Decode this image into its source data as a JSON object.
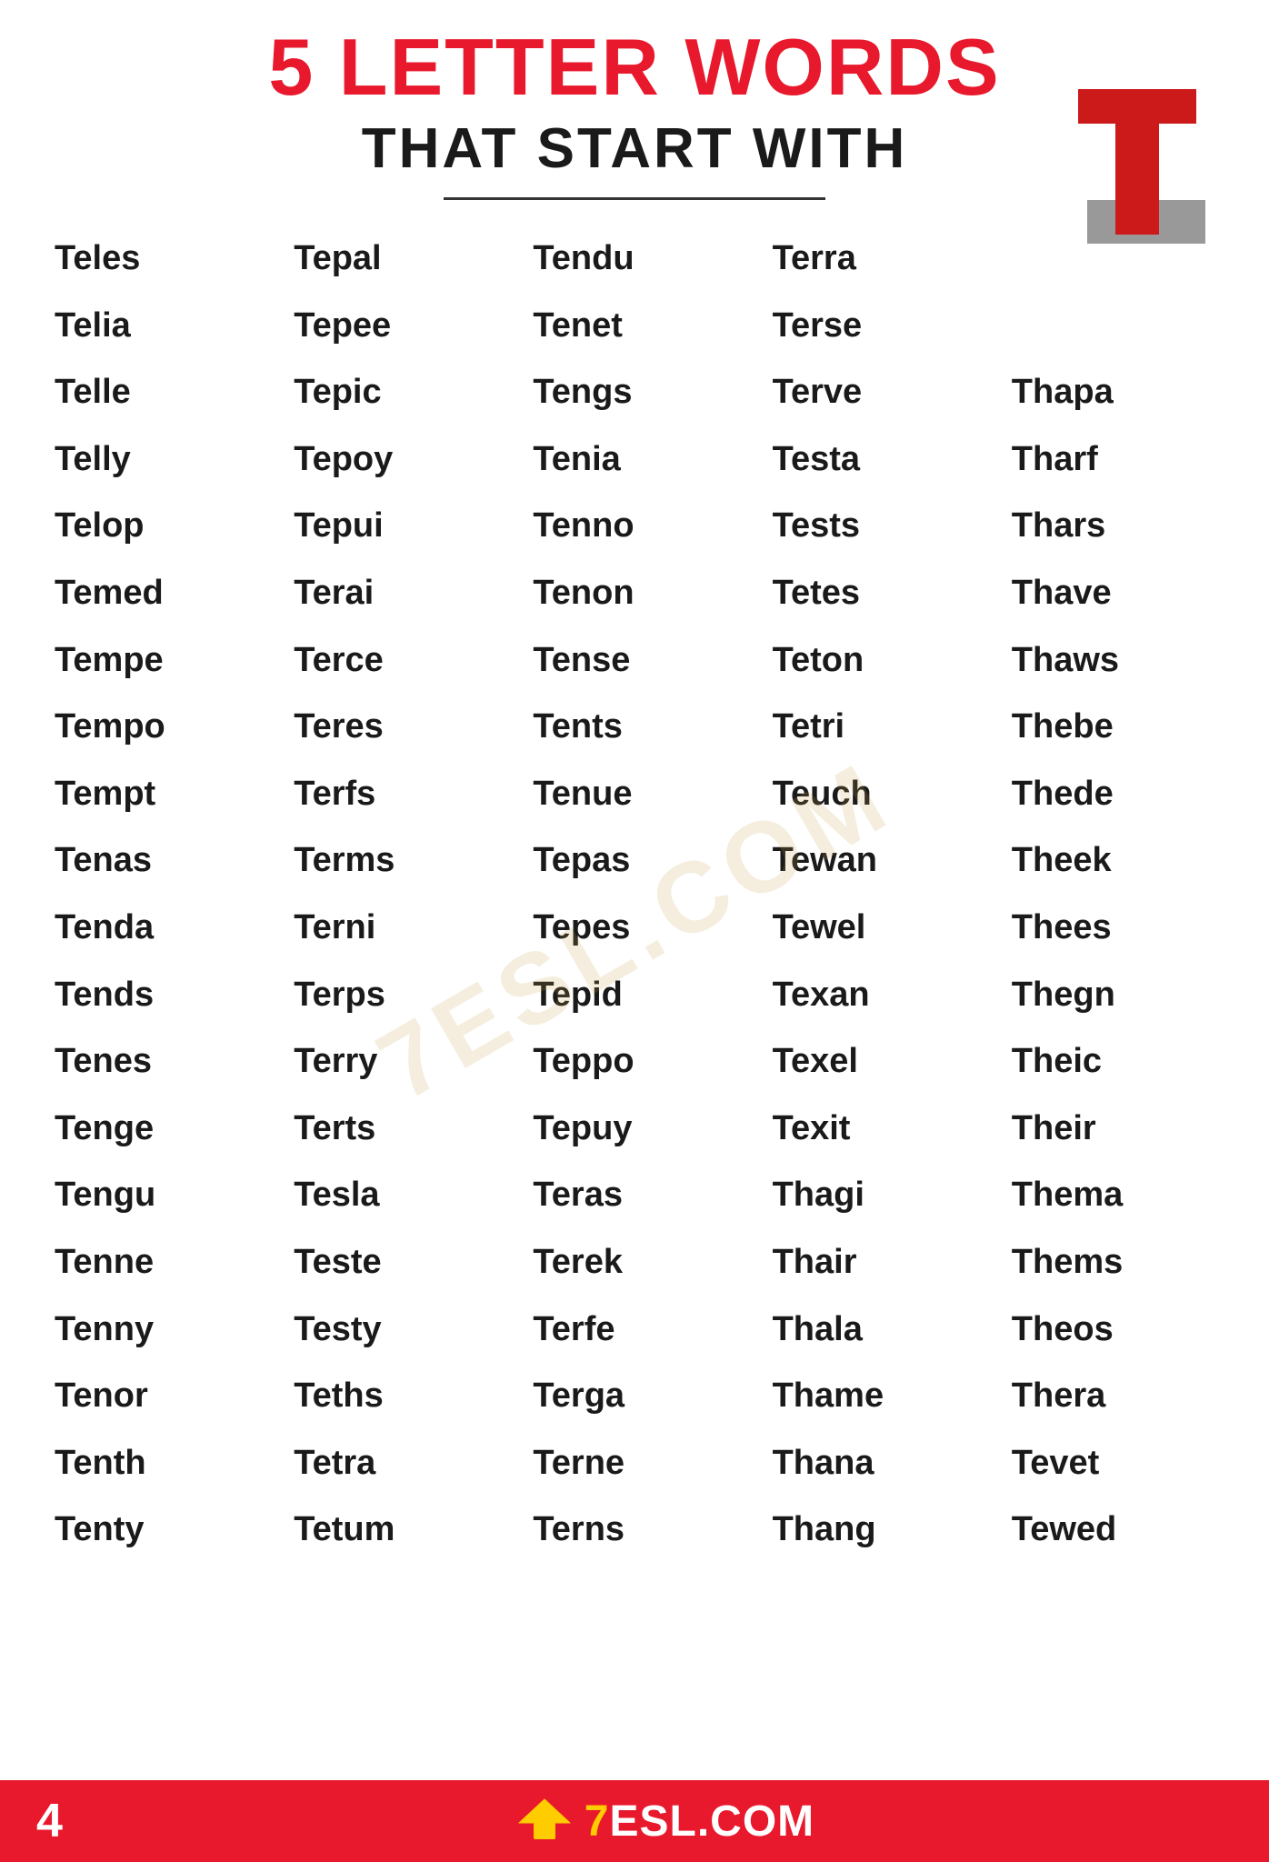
{
  "header": {
    "main_title": "5 LETTER WORDS",
    "subtitle": "THAT START WITH",
    "big_letter": "T"
  },
  "footer": {
    "page_number": "4",
    "logo_text": "7ESL.COM"
  },
  "words": [
    [
      "Teles",
      "Tepal",
      "Tendu",
      "Terra",
      ""
    ],
    [
      "Telia",
      "Tepee",
      "Tenet",
      "Terse",
      ""
    ],
    [
      "Telle",
      "Tepic",
      "Tengs",
      "Terve",
      "Thapa"
    ],
    [
      "Telly",
      "Tepoy",
      "Tenia",
      "Testa",
      "Tharf"
    ],
    [
      "Telop",
      "Tepui",
      "Tenno",
      "Tests",
      "Thars"
    ],
    [
      "Temed",
      "Terai",
      "Tenon",
      "Tetes",
      "Thave"
    ],
    [
      "Tempe",
      "Terce",
      "Tense",
      "Teton",
      "Thaws"
    ],
    [
      "Tempo",
      "Teres",
      "Tents",
      "Tetri",
      "Thebe"
    ],
    [
      "Tempt",
      "Terfs",
      "Tenue",
      "Teuch",
      "Thede"
    ],
    [
      "Tenas",
      "Terms",
      "Tepas",
      "Tewan",
      "Theek"
    ],
    [
      "Tenda",
      "Terni",
      "Tepes",
      "Tewel",
      "Thees"
    ],
    [
      "Tends",
      "Terps",
      "Tepid",
      "Texan",
      "Thegn"
    ],
    [
      "Tenes",
      "Terry",
      "Teppo",
      "Texel",
      "Theic"
    ],
    [
      "Tenge",
      "Terts",
      "Tepuy",
      "Texit",
      "Their"
    ],
    [
      "Tengu",
      "Tesla",
      "Teras",
      "Thagi",
      "Thema"
    ],
    [
      "Tenne",
      "Teste",
      "Terek",
      "Thair",
      "Thems"
    ],
    [
      "Tenny",
      "Testy",
      "Terfe",
      "Thala",
      "Theos"
    ],
    [
      "Tenor",
      "Teths",
      "Terga",
      "Thame",
      "Thera"
    ],
    [
      "Tenth",
      "Tetra",
      "Terne",
      "Thana",
      "Tevet"
    ],
    [
      "Tenty",
      "Tetum",
      "Terns",
      "Thang",
      "Tewed"
    ]
  ]
}
